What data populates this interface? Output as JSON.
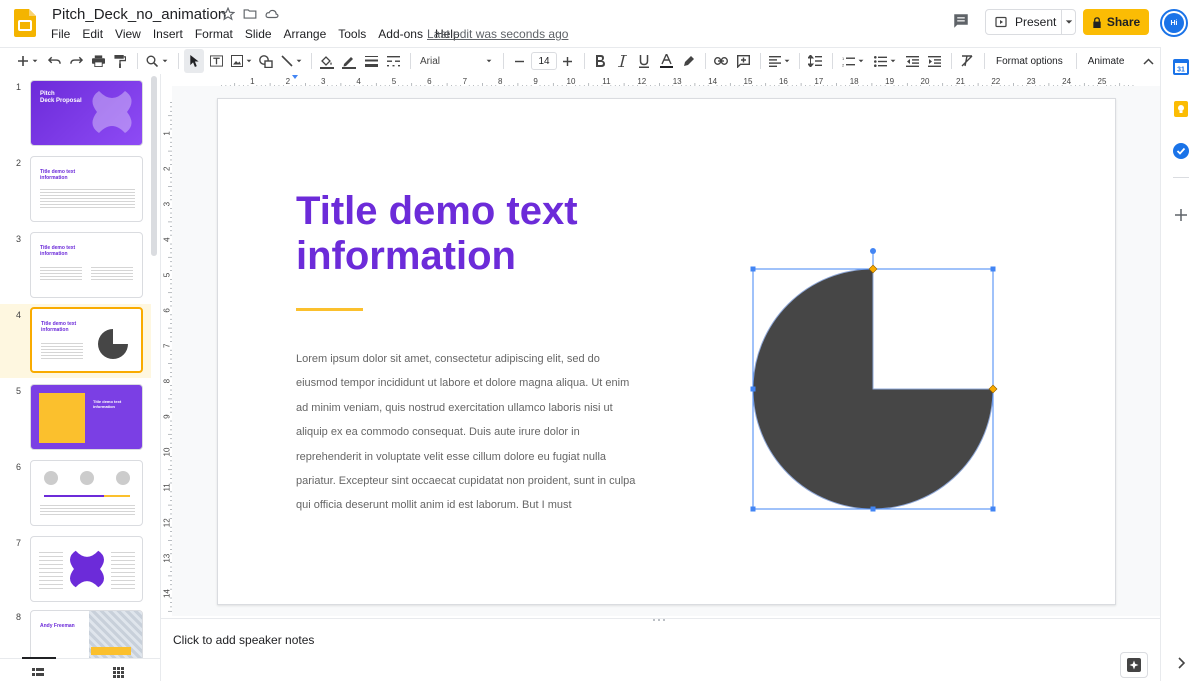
{
  "header": {
    "doc_title": "Pitch_Deck_no_animation",
    "last_edit": "Last edit was seconds ago",
    "present_label": "Present",
    "share_label": "Share",
    "avatar_initials": "Hi"
  },
  "menu": [
    "File",
    "Edit",
    "View",
    "Insert",
    "Format",
    "Slide",
    "Arrange",
    "Tools",
    "Add-ons",
    "Help"
  ],
  "toolbar": {
    "font": "Arial",
    "font_size": "14",
    "format_options": "Format options",
    "animate": "Animate"
  },
  "ruler": {
    "top": [
      "1",
      "2",
      "3",
      "4",
      "5",
      "6",
      "7",
      "8",
      "9",
      "10",
      "11",
      "12",
      "13",
      "14",
      "15",
      "16",
      "17",
      "18",
      "19",
      "20",
      "21",
      "22",
      "23",
      "24",
      "25"
    ],
    "left": [
      "1",
      "2",
      "3",
      "4",
      "5",
      "6",
      "7",
      "8",
      "9",
      "10",
      "11",
      "12",
      "13",
      "14"
    ]
  },
  "filmstrip": {
    "slides": [
      {
        "num": "1",
        "title": "Pitch\nDeck Proposal"
      },
      {
        "num": "2",
        "title": "Title demo text\ninformation"
      },
      {
        "num": "3",
        "title": "Title demo text\ninformation"
      },
      {
        "num": "4",
        "title": "Title demo text\ninformation"
      },
      {
        "num": "5",
        "title": "Title demo text\ninformation"
      },
      {
        "num": "6",
        "title": ""
      },
      {
        "num": "7",
        "title": ""
      },
      {
        "num": "8",
        "title": "Andy Freeman"
      }
    ],
    "active_index": 3
  },
  "slide": {
    "title": "Title demo text\ninformation",
    "body": "Lorem ipsum dolor sit amet, consectetur adipiscing elit, sed do eiusmod tempor incididunt ut labore et dolore magna aliqua. Ut enim ad minim veniam, quis nostrud exercitation ullamco laboris nisi ut aliquip ex ea commodo consequat. Duis aute irure dolor in reprehenderit in voluptate velit esse cillum dolore eu fugiat nulla pariatur. Excepteur sint occaecat cupidatat non proident, sunt in culpa qui officia deserunt mollit anim id est laborum. But I must"
  },
  "notes": {
    "placeholder": "Click to add speaker notes"
  },
  "colors": {
    "brand_purple": "#6c2bd9",
    "accent_yellow": "#fbc02d",
    "pie_fill": "#464646",
    "selection_blue": "#1a73e8",
    "share_yellow": "#fbbc04"
  }
}
